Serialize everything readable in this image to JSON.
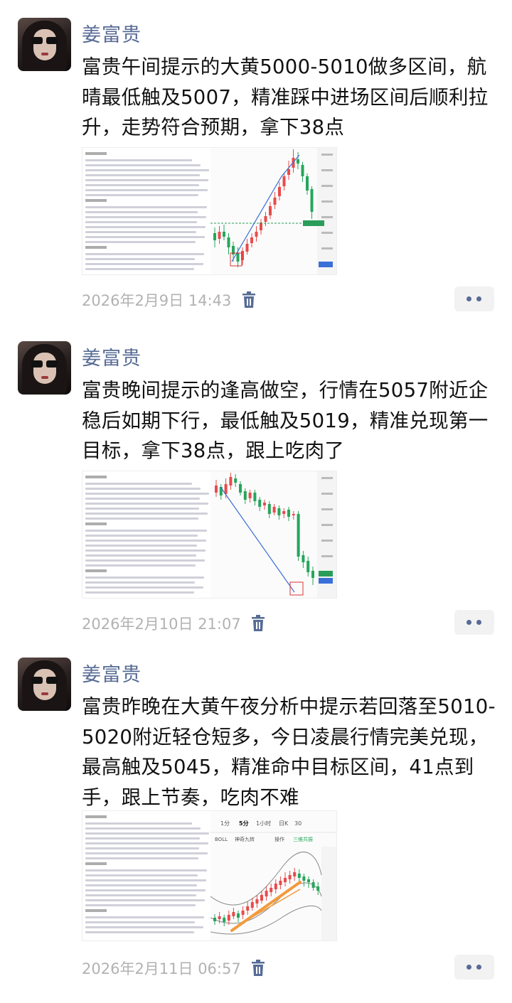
{
  "posts": [
    {
      "author": "姜富贵",
      "text": "富贵午间提示的大黄5000-5010做多区间，航晴最低触及5007，精准踩中进场区间后顺利拉升，走势符合预期，拿下38点",
      "timestamp": "2026年2月9日 14:43",
      "image": {
        "doc_line_count": 24
      }
    },
    {
      "author": "姜富贵",
      "text": "富贵晚间提示的逢高做空，行情在5057附近企稳后如期下行，最低触及5019，精准兑现第一目标，拿下38点，跟上吃肉了",
      "timestamp": "2026年2月10日 21:07",
      "image": {
        "doc_line_count": 24
      }
    },
    {
      "author": "姜富贵",
      "text": "富贵昨晚在大黄午夜分析中提示若回落至5010-5020附近轻仓短多，今日凌晨行情完美兑现，最高触及5045，精准命中目标区间，41点到手，跟上节奏，吃肉不难",
      "timestamp": "2026年2月11日 06:57",
      "image": {
        "tabs": [
          "1分",
          "5分",
          "1小时",
          "日K",
          "30"
        ],
        "indicators": [
          "BOLL",
          "神奇九转",
          "操作",
          "三维共振"
        ]
      }
    }
  ],
  "colors": {
    "name": "#576b95",
    "text": "#111111",
    "meta": "#b2b2b2",
    "up": "#e84b4b",
    "down": "#26a65b",
    "trend": "#f39a3c"
  },
  "icons": {
    "delete": "trash-icon",
    "more": "more-dots-icon"
  }
}
